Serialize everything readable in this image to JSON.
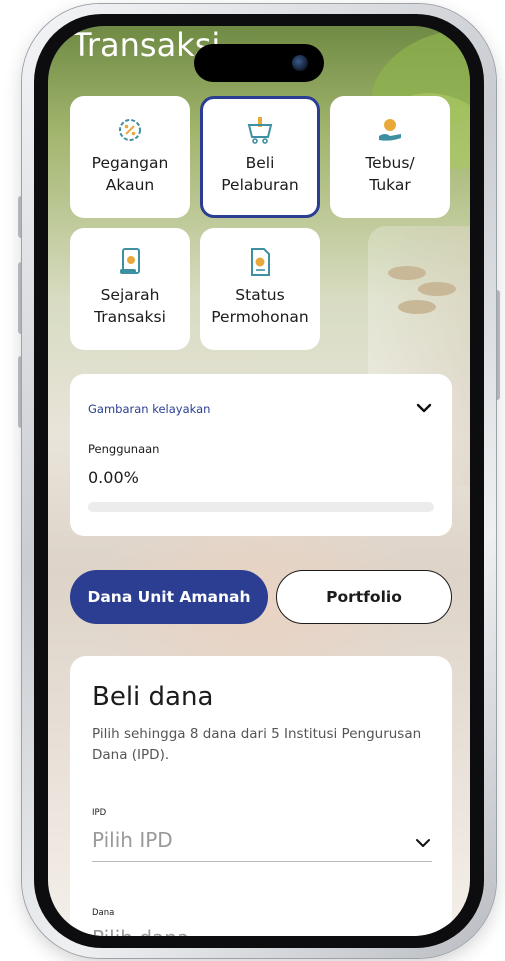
{
  "header": {
    "title": "Transaksi"
  },
  "actions": [
    {
      "line1": "Pegangan",
      "line2": "Akaun",
      "icon": "percent-badge-icon"
    },
    {
      "line1": "Beli",
      "line2": "Pelaburan",
      "icon": "shopping-cart-icon",
      "selected": true
    },
    {
      "line1": "Tebus/",
      "line2": "Tukar",
      "icon": "hand-coin-icon"
    },
    {
      "line1": "Sejarah",
      "line2": "Transaksi",
      "icon": "scroll-icon"
    },
    {
      "line1": "Status",
      "line2": "Permohonan",
      "icon": "document-check-icon"
    }
  ],
  "eligibility": {
    "title": "Gambaran kelayakan",
    "usage_label": "Penggunaan",
    "usage_value": "0.00%",
    "usage_fraction": 0.0
  },
  "segments": {
    "primary": "Dana Unit Amanah",
    "secondary": "Portfolio"
  },
  "buy_fund": {
    "title": "Beli dana",
    "description": "Pilih sehingga 8 dana dari 5 Institusi Pengurusan Dana (IPD).",
    "ipd": {
      "label": "IPD",
      "value": "Pilih IPD"
    },
    "fund": {
      "label": "Dana",
      "value": "Pilih dana"
    }
  },
  "colors": {
    "accent": "#2b3e92",
    "icon_amber": "#e8a93a",
    "icon_teal": "#3f8fa3"
  }
}
